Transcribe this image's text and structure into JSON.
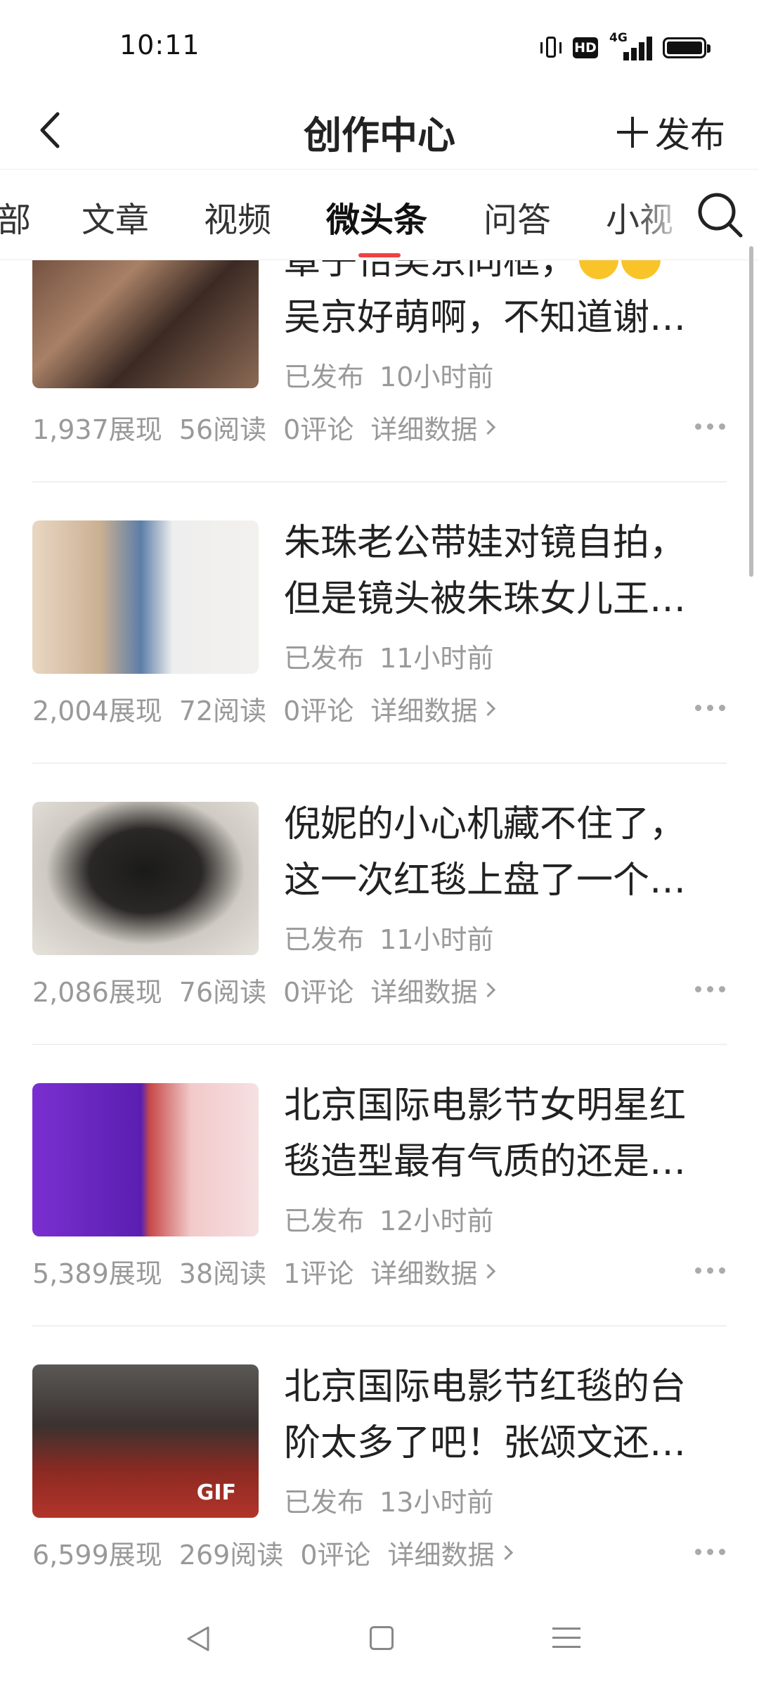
{
  "status_bar": {
    "time": "10:11",
    "hd_label": "HD",
    "network_label": "4G"
  },
  "header": {
    "title": "创作中心",
    "publish_label": "发布"
  },
  "tabs": [
    {
      "label": "部"
    },
    {
      "label": "文章"
    },
    {
      "label": "视频"
    },
    {
      "label": "微头条",
      "active": true
    },
    {
      "label": "问答"
    },
    {
      "label": "小视"
    }
  ],
  "feed": {
    "items": [
      {
        "title_line1": "章子怡吴京同框，",
        "title_line2": "吴京好萌啊，不知道谢…",
        "status": "已发布",
        "time": "10小时前",
        "impressions": "1,937展现",
        "reads": "56阅读",
        "comments": "0评论",
        "detail": "详细数据"
      },
      {
        "title_line1": "朱珠老公带娃对镜自拍，",
        "title_line2": "但是镜头被朱珠女儿王…",
        "status": "已发布",
        "time": "11小时前",
        "impressions": "2,004展现",
        "reads": "72阅读",
        "comments": "0评论",
        "detail": "详细数据"
      },
      {
        "title_line1": "倪妮的小心机藏不住了，",
        "title_line2": "这一次红毯上盘了一个…",
        "status": "已发布",
        "time": "11小时前",
        "impressions": "2,086展现",
        "reads": "76阅读",
        "comments": "0评论",
        "detail": "详细数据"
      },
      {
        "title_line1": "北京国际电影节女明星红",
        "title_line2": "毯造型最有气质的还是…",
        "status": "已发布",
        "time": "12小时前",
        "impressions": "5,389展现",
        "reads": "38阅读",
        "comments": "1评论",
        "detail": "详细数据"
      },
      {
        "title_line1": "北京国际电影节红毯的台",
        "title_line2": "阶太多了吧！张颂文还…",
        "status": "已发布",
        "time": "13小时前",
        "impressions": "6,599展现",
        "reads": "269阅读",
        "comments": "0评论",
        "detail": "详细数据",
        "badge": "GIF"
      }
    ]
  },
  "colors": {
    "accent": "#f04142",
    "text": "#222222",
    "muted": "#999999"
  }
}
